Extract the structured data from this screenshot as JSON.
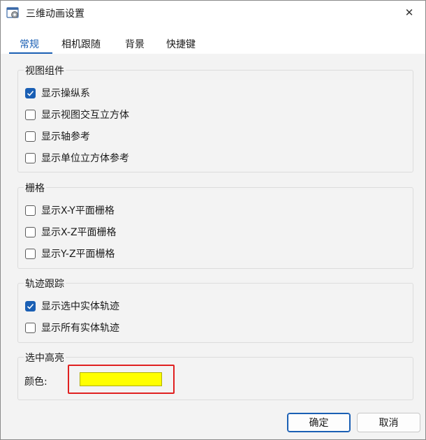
{
  "window": {
    "title": "三维动画设置",
    "close_symbol": "✕"
  },
  "tabs": [
    {
      "label": "常规",
      "active": true
    },
    {
      "label": "相机跟随",
      "active": false
    },
    {
      "label": "背景",
      "active": false
    },
    {
      "label": "快捷键",
      "active": false
    }
  ],
  "groups": {
    "view_components": {
      "title": "视图组件",
      "items": [
        {
          "label": "显示操纵系",
          "checked": true
        },
        {
          "label": "显示视图交互立方体",
          "checked": false
        },
        {
          "label": "显示轴参考",
          "checked": false
        },
        {
          "label": "显示单位立方体参考",
          "checked": false
        }
      ]
    },
    "grid": {
      "title": "栅格",
      "items": [
        {
          "label": "显示X-Y平面栅格",
          "checked": false
        },
        {
          "label": "显示X-Z平面栅格",
          "checked": false
        },
        {
          "label": "显示Y-Z平面栅格",
          "checked": false
        }
      ]
    },
    "trace": {
      "title": "轨迹跟踪",
      "items": [
        {
          "label": "显示选中实体轨迹",
          "checked": true
        },
        {
          "label": "显示所有实体轨迹",
          "checked": false
        }
      ]
    },
    "highlight": {
      "title": "选中高亮",
      "color_label": "颜色:",
      "color_value": "#ffff00",
      "annotation_color": "#e02020"
    }
  },
  "buttons": {
    "ok": "确定",
    "cancel": "取消"
  },
  "colors": {
    "accent": "#1a5fb4",
    "background": "#f3f3f3"
  }
}
